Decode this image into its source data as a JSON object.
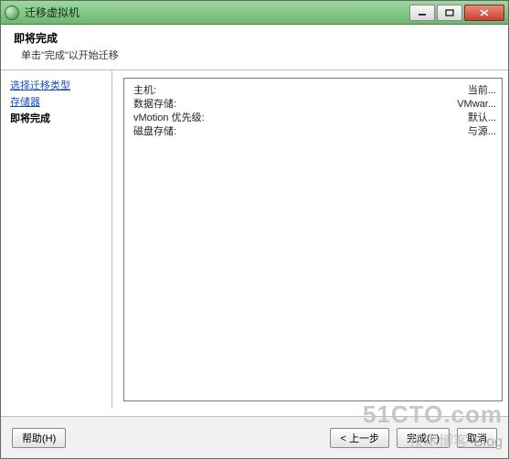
{
  "window": {
    "title": "迁移虚拟机"
  },
  "header": {
    "title": "即将完成",
    "subtitle": "单击\"完成\"以开始迁移"
  },
  "sidebar": {
    "links": [
      {
        "label": "选择迁移类型"
      },
      {
        "label": "存储器"
      }
    ],
    "current": "即将完成"
  },
  "details": {
    "rows": [
      {
        "key": "主机:",
        "value": "当前..."
      },
      {
        "key": "数据存储:",
        "value": "VMwar..."
      },
      {
        "key": "vMotion 优先级:",
        "value": "默认..."
      },
      {
        "key": "磁盘存储:",
        "value": "与源..."
      }
    ]
  },
  "footer": {
    "help": "帮助(H)",
    "back": "< 上一步",
    "finish": "完成(F)",
    "cancel": "取消"
  },
  "watermark": {
    "line1": "51CTO.com",
    "line2_a": "技术博客",
    "line2_b": "Blog"
  }
}
